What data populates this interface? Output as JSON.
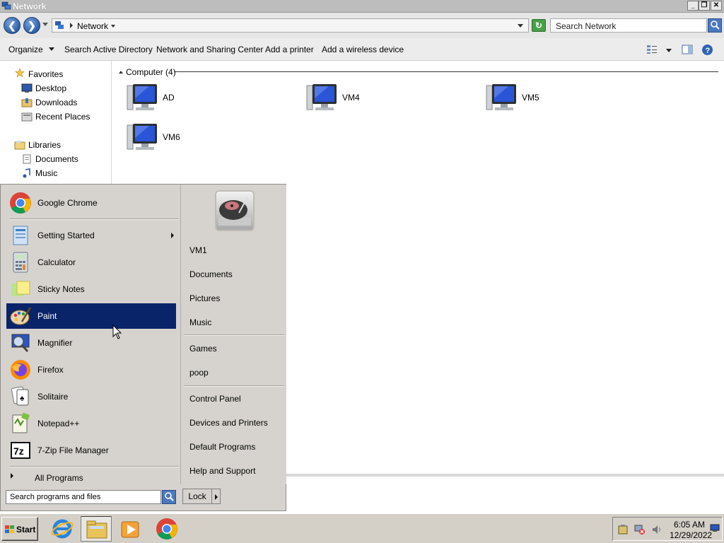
{
  "window": {
    "title": "Network",
    "buttons": {
      "minimize": "_",
      "restore": "❐",
      "close": "✕"
    }
  },
  "address": {
    "crumb": "Network",
    "search_placeholder": "Search Network"
  },
  "toolbar": {
    "organize": "Organize",
    "search_ad": "Search Active Directory",
    "network_sharing": "Network and Sharing Center",
    "add_printer": "Add a printer",
    "add_wireless": "Add a wireless device"
  },
  "nav": {
    "favorites": "Favorites",
    "desktop": "Desktop",
    "downloads": "Downloads",
    "recent": "Recent Places",
    "libraries": "Libraries",
    "documents": "Documents",
    "music": "Music"
  },
  "content": {
    "group_header": "Computer (4)",
    "computers": [
      "AD",
      "VM4",
      "VM5",
      "VM6"
    ]
  },
  "startmenu": {
    "pinned": "Google Chrome",
    "items": [
      "Getting Started",
      "Calculator",
      "Sticky Notes",
      "Paint",
      "Magnifier",
      "Firefox",
      "Solitaire",
      "Notepad++",
      "7-Zip File Manager"
    ],
    "selected": "Paint",
    "all_programs": "All Programs",
    "search_placeholder": "Search programs and files",
    "right": {
      "user": "VM1",
      "documents": "Documents",
      "pictures": "Pictures",
      "music": "Music",
      "games": "Games",
      "poop": "poop",
      "control_panel": "Control Panel",
      "devices": "Devices and Printers",
      "default_programs": "Default Programs",
      "help": "Help and Support"
    },
    "lock": "Lock"
  },
  "taskbar": {
    "start": "Start",
    "time": "6:05 AM",
    "date": "12/29/2022"
  },
  "colors": {
    "selection": "#0a246a",
    "menu_bg": "#d6d3ce",
    "taskbar_bg": "#d4d0c8"
  }
}
